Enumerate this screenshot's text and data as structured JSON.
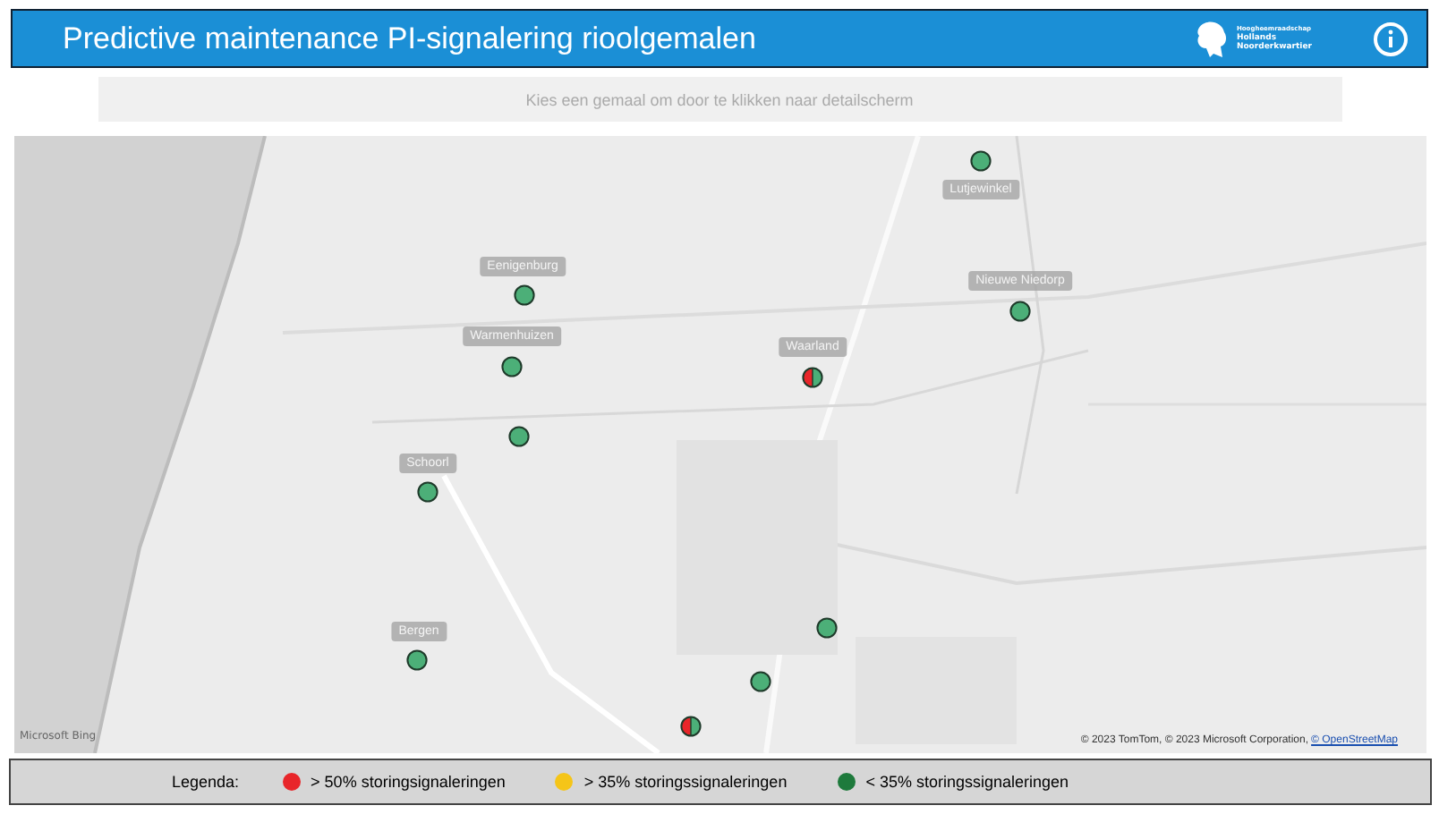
{
  "header": {
    "title": "Predictive maintenance PI-signalering rioolgemalen",
    "logo_lines": [
      "Hoogheemraadschap",
      "Hollands",
      "Noorderkwartier"
    ]
  },
  "filter_bar": {
    "placeholder": "Kies een gemaal om door te klikken naar detailscherm"
  },
  "map": {
    "markers": [
      {
        "label": "Lutjewinkel",
        "kind": "low"
      },
      {
        "label": "Nieuwe Niedorp",
        "kind": "low"
      },
      {
        "label": "Eenigenburg",
        "kind": "low"
      },
      {
        "label": "Warmenhuizen",
        "kind": "low"
      },
      {
        "kind": "low"
      },
      {
        "label": "Schoorl",
        "kind": "low"
      },
      {
        "label": "Bergen",
        "kind": "low"
      },
      {
        "label": "Waarland",
        "kind": "split"
      },
      {
        "kind": "low"
      },
      {
        "kind": "low"
      },
      {
        "kind": "split"
      }
    ],
    "brand": "Microsoft Bing",
    "attribution": "© 2023 TomTom, © 2023 Microsoft Corporation,",
    "attribution_link": "© OpenStreetMap"
  },
  "legend": {
    "title": "Legenda:",
    "items": [
      {
        "label": "> 50% storingsignaleringen",
        "color": "#e8262a"
      },
      {
        "label": "> 35% storingssignaleringen",
        "color": "#f5c518"
      },
      {
        "label": "< 35% storingssignaleringen",
        "color": "#1e7a3c"
      }
    ]
  }
}
